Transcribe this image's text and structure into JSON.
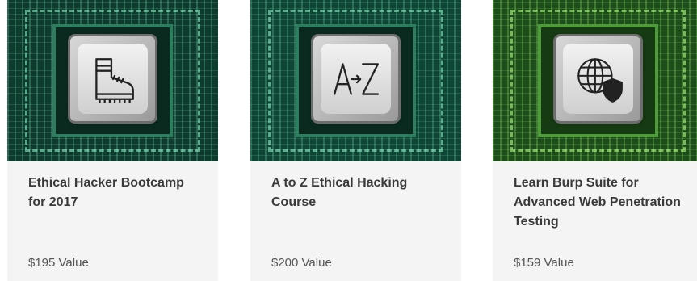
{
  "cards": [
    {
      "title": "Ethical Hacker Bootcamp for 2017",
      "price": "$195 Value",
      "icon": "boot-icon"
    },
    {
      "title": "A to Z Ethical Hacking Course",
      "price": "$200 Value",
      "icon": "a-to-z-icon"
    },
    {
      "title": "Learn Burp Suite for Advanced Web Penetration Testing",
      "price": "$159 Value",
      "icon": "globe-shield-icon"
    }
  ],
  "colors": {
    "card_bg": "#f4f4f4",
    "title": "#3a3a3a",
    "price": "#555555",
    "circuit_green": "#0f4535"
  }
}
